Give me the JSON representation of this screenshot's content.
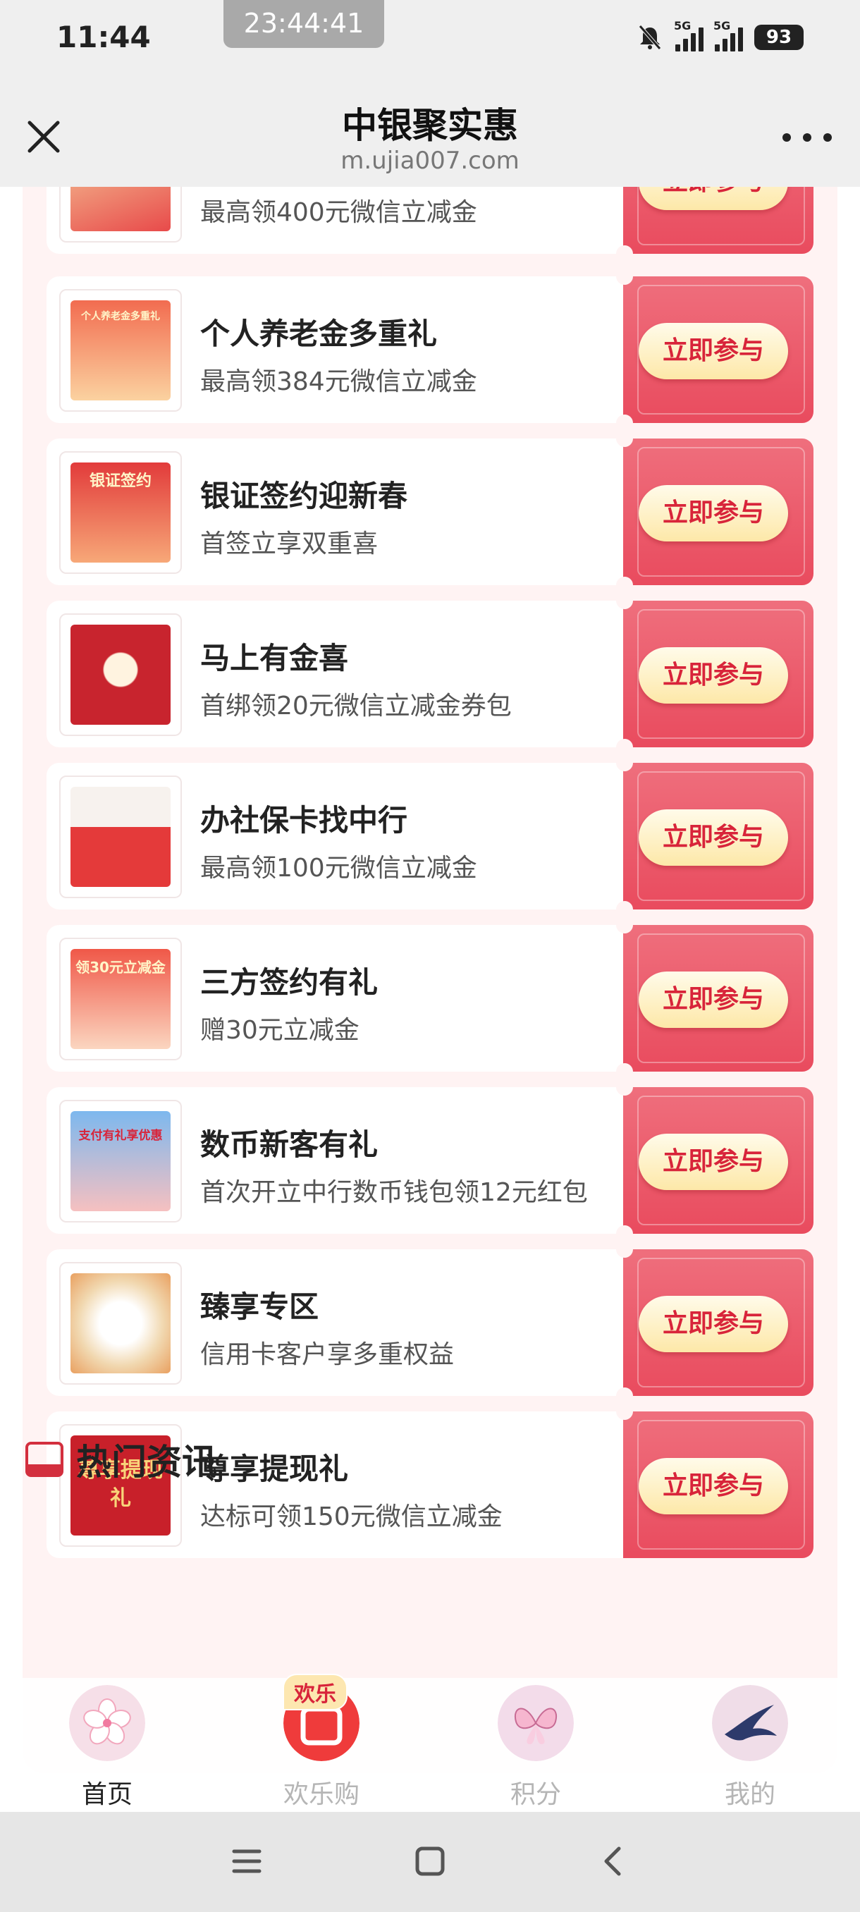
{
  "status_bar": {
    "time": "11:44",
    "recording_time": "23:44:41",
    "network_1": "5G",
    "network_2": "5G",
    "battery": "93"
  },
  "browser": {
    "title": "中银聚实惠",
    "url": "m.ujia007.com"
  },
  "campaigns": [
    {
      "title": "",
      "subtitle": "最高领400元微信立减金",
      "button": "立即参与",
      "thumb_color": "#e84a4a"
    },
    {
      "title": "个人养老金多重礼",
      "subtitle": "最高领384元微信立减金",
      "button": "立即参与",
      "thumb_color": "#f05a4a",
      "thumb_text": "个人养老金多重礼"
    },
    {
      "title": "银证签约迎新春",
      "subtitle": "首签立享双重喜",
      "button": "立即参与",
      "thumb_color": "#e23b3b",
      "thumb_text": "银证签约"
    },
    {
      "title": "马上有金喜",
      "subtitle": "首绑领20元微信立减金券包",
      "button": "立即参与",
      "thumb_color": "#c8242e"
    },
    {
      "title": "办社保卡找中行",
      "subtitle": "最高领100元微信立减金",
      "button": "立即参与",
      "thumb_color": "#e43a3a"
    },
    {
      "title": "三方签约有礼",
      "subtitle": "赠30元立减金",
      "button": "立即参与",
      "thumb_color": "#f05848",
      "thumb_text": "领30元立减金"
    },
    {
      "title": "数币新客有礼",
      "subtitle": "首次开立中行数币钱包领12元红包",
      "button": "立即参与",
      "thumb_color": "#5fa8e8",
      "thumb_text": "支付有礼享优惠"
    },
    {
      "title": "臻享专区",
      "subtitle": "信用卡客户享多重权益",
      "button": "立即参与",
      "thumb_color": "#f1d8b0"
    },
    {
      "title": "尊享提现礼",
      "subtitle": "达标可领150元微信立减金",
      "button": "立即参与",
      "thumb_color": "#c8202a",
      "thumb_text": "尊享提现礼"
    }
  ],
  "news": {
    "title": "热门资讯"
  },
  "tabbar": {
    "items": [
      {
        "label": "首页",
        "icon": "cherry-blossom-icon"
      },
      {
        "label": "欢乐购",
        "icon": "shopping-bag-icon",
        "badge": "欢乐"
      },
      {
        "label": "积分",
        "icon": "butterfly-icon"
      },
      {
        "label": "我的",
        "icon": "swallow-icon"
      }
    ]
  },
  "colors": {
    "accent_red": "#e94b5e",
    "button_text": "#d8243a"
  }
}
